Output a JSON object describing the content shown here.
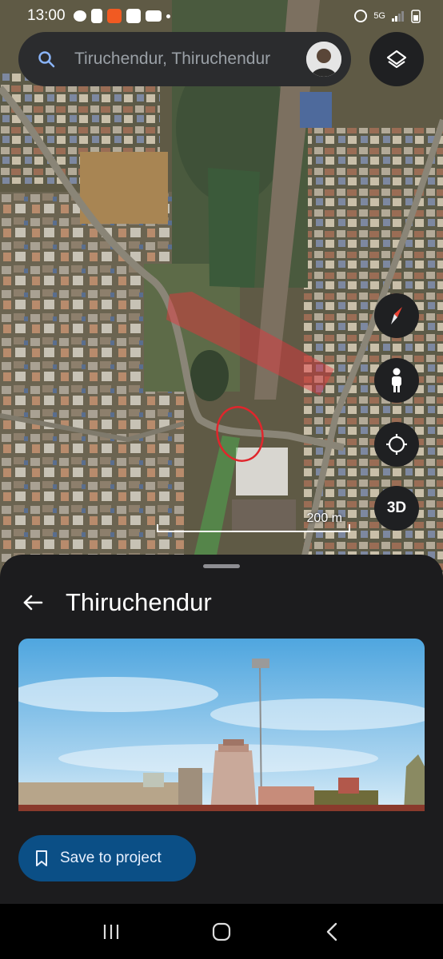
{
  "status_bar": {
    "time": "13:00",
    "network": "5G"
  },
  "search": {
    "text": "Tiruchendur, Thiruchendur"
  },
  "map": {
    "scale_label": "200 m",
    "three_d_label": "3D"
  },
  "sheet": {
    "title": "Thiruchendur",
    "save_label": "Save to project"
  },
  "colors": {
    "accent": "#0b4f86",
    "highlight_red": "#e8323c",
    "highlight_green": "#4caf50",
    "sheet_bg": "#1c1c1e"
  },
  "icons": [
    "search-icon",
    "layers-icon",
    "compass-icon",
    "pegman-icon",
    "my-location-icon",
    "back-arrow-icon",
    "bookmark-icon",
    "recents-icon",
    "home-icon",
    "back-nav-icon"
  ]
}
